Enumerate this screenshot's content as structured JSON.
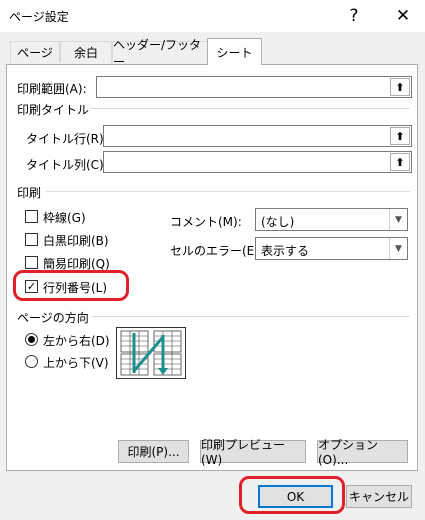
{
  "window": {
    "title": "ページ設定",
    "help_label": "?",
    "close_label": "✕"
  },
  "tabs": [
    {
      "label": "ページ"
    },
    {
      "label": "余白"
    },
    {
      "label": "ヘッダー/フッター"
    },
    {
      "label": "シート"
    }
  ],
  "print_area": {
    "label": "印刷範囲(A):",
    "value": ""
  },
  "print_titles": {
    "group_label": "印刷タイトル",
    "rows_label": "タイトル行(R):",
    "rows_value": "",
    "cols_label": "タイトル列(C):",
    "cols_value": ""
  },
  "print": {
    "group_label": "印刷",
    "gridlines": {
      "label": "枠線(G)",
      "checked": false
    },
    "black_white": {
      "label": "白黒印刷(B)",
      "checked": false
    },
    "draft": {
      "label": "簡易印刷(Q)",
      "checked": false
    },
    "row_col_headings": {
      "label": "行列番号(L)",
      "checked": true
    },
    "comments_label": "コメント(M):",
    "comments_value": "(なし)",
    "cell_errors_label": "セルのエラー(E):",
    "cell_errors_value": "表示する"
  },
  "page_order": {
    "group_label": "ページの方向",
    "down_then_over": {
      "label": "左から右(D)",
      "selected": true
    },
    "over_then_down": {
      "label": "上から下(V)",
      "selected": false
    }
  },
  "panel_buttons": {
    "print": "印刷(P)...",
    "preview": "印刷プレビュー(W)",
    "options": "オプション(O)..."
  },
  "footer": {
    "ok": "OK",
    "cancel": "キャンセル"
  },
  "colors": {
    "highlight": "#e0202a",
    "accent": "#0078d7",
    "arrow": "#1e8f8f"
  },
  "icons": {
    "collapse": "collapse-dialog-icon",
    "dropdown": "chevron-down-icon"
  }
}
